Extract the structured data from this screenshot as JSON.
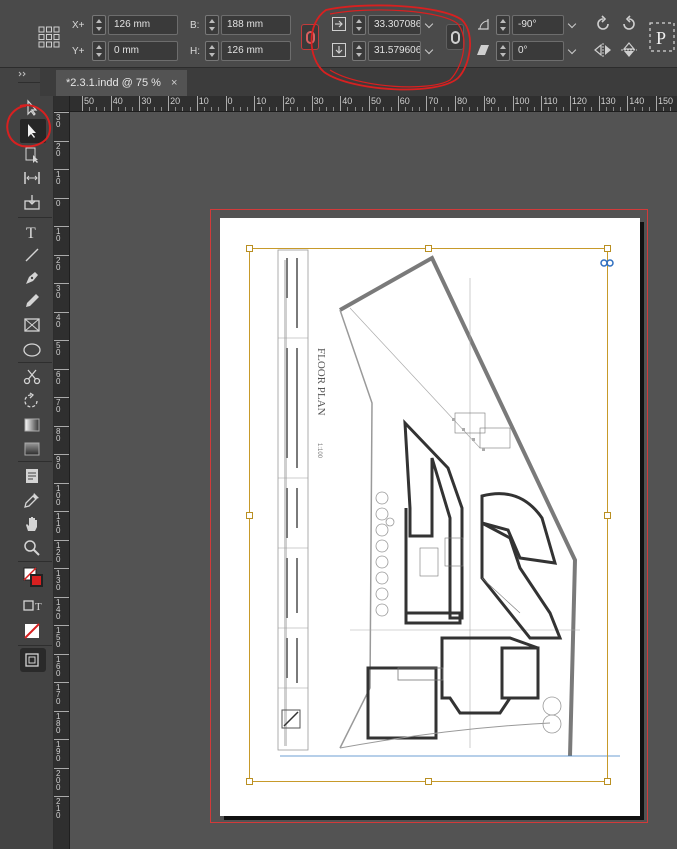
{
  "control_panel": {
    "x_label": "X+",
    "x_value": "126 mm",
    "y_label": "Y+",
    "y_value": "0 mm",
    "w_label": "B:",
    "w_value": "188 mm",
    "h_label": "H:",
    "h_value": "126 mm",
    "scale_x_value": "33.3070866",
    "scale_y_value": "31.5796065",
    "rotation_value": "-90°",
    "shear_value": "0°"
  },
  "document_tab": {
    "title": "*2.3.1.indd @ 75 %",
    "close_glyph": "×"
  },
  "h_ruler_labels": [
    "50",
    "40",
    "30",
    "20",
    "10",
    "0",
    "10",
    "20",
    "30",
    "40",
    "50",
    "60",
    "70",
    "80",
    "90",
    "100",
    "110",
    "120",
    "130",
    "140",
    "150"
  ],
  "v_ruler_labels": [
    "30",
    "20",
    "10",
    "0",
    "10",
    "20",
    "30",
    "40",
    "50",
    "60",
    "70",
    "80",
    "90",
    "100",
    "110",
    "120",
    "130",
    "140",
    "150",
    "160",
    "170",
    "180",
    "190",
    "200",
    "210"
  ],
  "tools": [
    {
      "icon": "direct-selection-icon"
    },
    {
      "icon": "selection-icon",
      "active": true
    },
    {
      "icon": "page-tool-icon"
    },
    {
      "icon": "gap-tool-icon"
    },
    {
      "icon": "content-collector-icon"
    },
    {
      "icon": "type-tool-icon"
    },
    {
      "icon": "line-tool-icon"
    },
    {
      "icon": "pen-tool-icon"
    },
    {
      "icon": "pencil-tool-icon"
    },
    {
      "icon": "rectangle-frame-icon"
    },
    {
      "icon": "ellipse-tool-icon"
    },
    {
      "icon": "scissors-tool-icon"
    },
    {
      "icon": "free-transform-icon"
    },
    {
      "icon": "gradient-swatch-icon"
    },
    {
      "icon": "gradient-feather-icon"
    },
    {
      "icon": "note-tool-icon"
    },
    {
      "icon": "eyedropper-tool-icon"
    },
    {
      "icon": "hand-tool-icon"
    },
    {
      "icon": "zoom-tool-icon"
    },
    {
      "icon": "fill-stroke-icon"
    },
    {
      "icon": "formatting-container-icon"
    },
    {
      "icon": "apply-none-icon"
    },
    {
      "icon": "screen-mode-icon"
    }
  ],
  "floor_plan": {
    "title": "FLOOR PLAN",
    "scale_note": "1:100"
  },
  "colors": {
    "annotation_red": "#d82020",
    "selection_frame": "#c79a2a",
    "bleed_guide": "#d23a3a"
  }
}
